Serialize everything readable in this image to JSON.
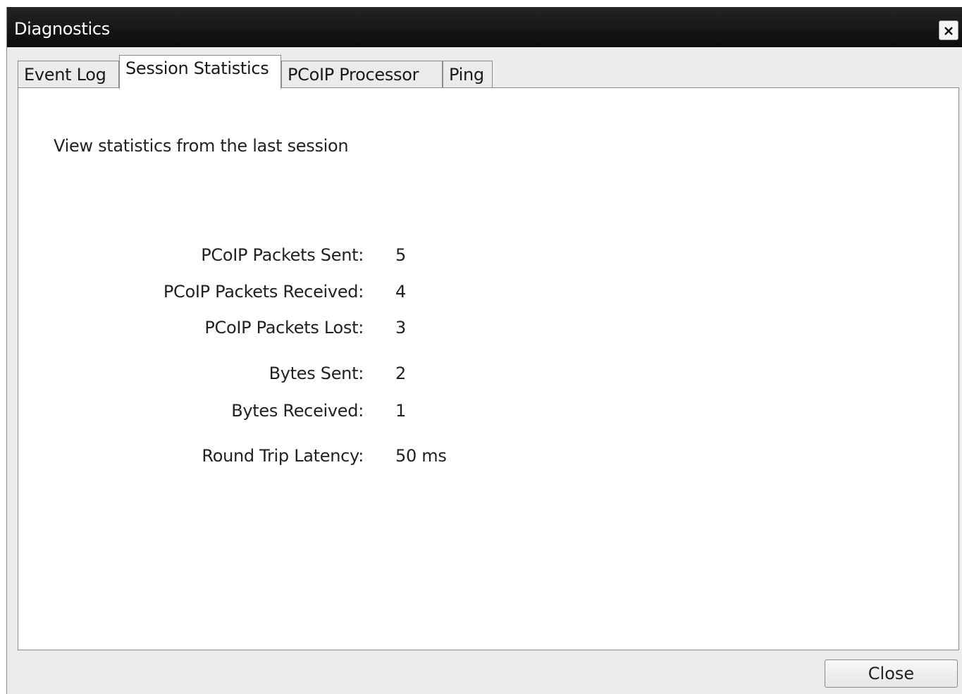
{
  "window": {
    "title": "Diagnostics",
    "close_icon_glyph": "✕"
  },
  "tabs": [
    {
      "label": "Event Log",
      "active": false
    },
    {
      "label": "Session Statistics",
      "active": true
    },
    {
      "label": "PCoIP Processor",
      "active": false
    },
    {
      "label": "Ping",
      "active": false
    }
  ],
  "panel": {
    "description": "View statistics from the last session",
    "stats": [
      {
        "label": "PCoIP Packets Sent:",
        "value": "5"
      },
      {
        "label": "PCoIP Packets Received:",
        "value": "4"
      },
      {
        "label": "PCoIP Packets Lost:",
        "value": "3"
      },
      {
        "label": "Bytes Sent:",
        "value": "2"
      },
      {
        "label": "Bytes Received:",
        "value": "1"
      },
      {
        "label": "Round Trip Latency:",
        "value": "50 ms"
      }
    ]
  },
  "footer": {
    "close_label": "Close"
  },
  "colors": {
    "titlebar": "#111111",
    "window_bg": "#ececec",
    "panel_bg": "#ffffff",
    "border": "#8c8c8c"
  }
}
